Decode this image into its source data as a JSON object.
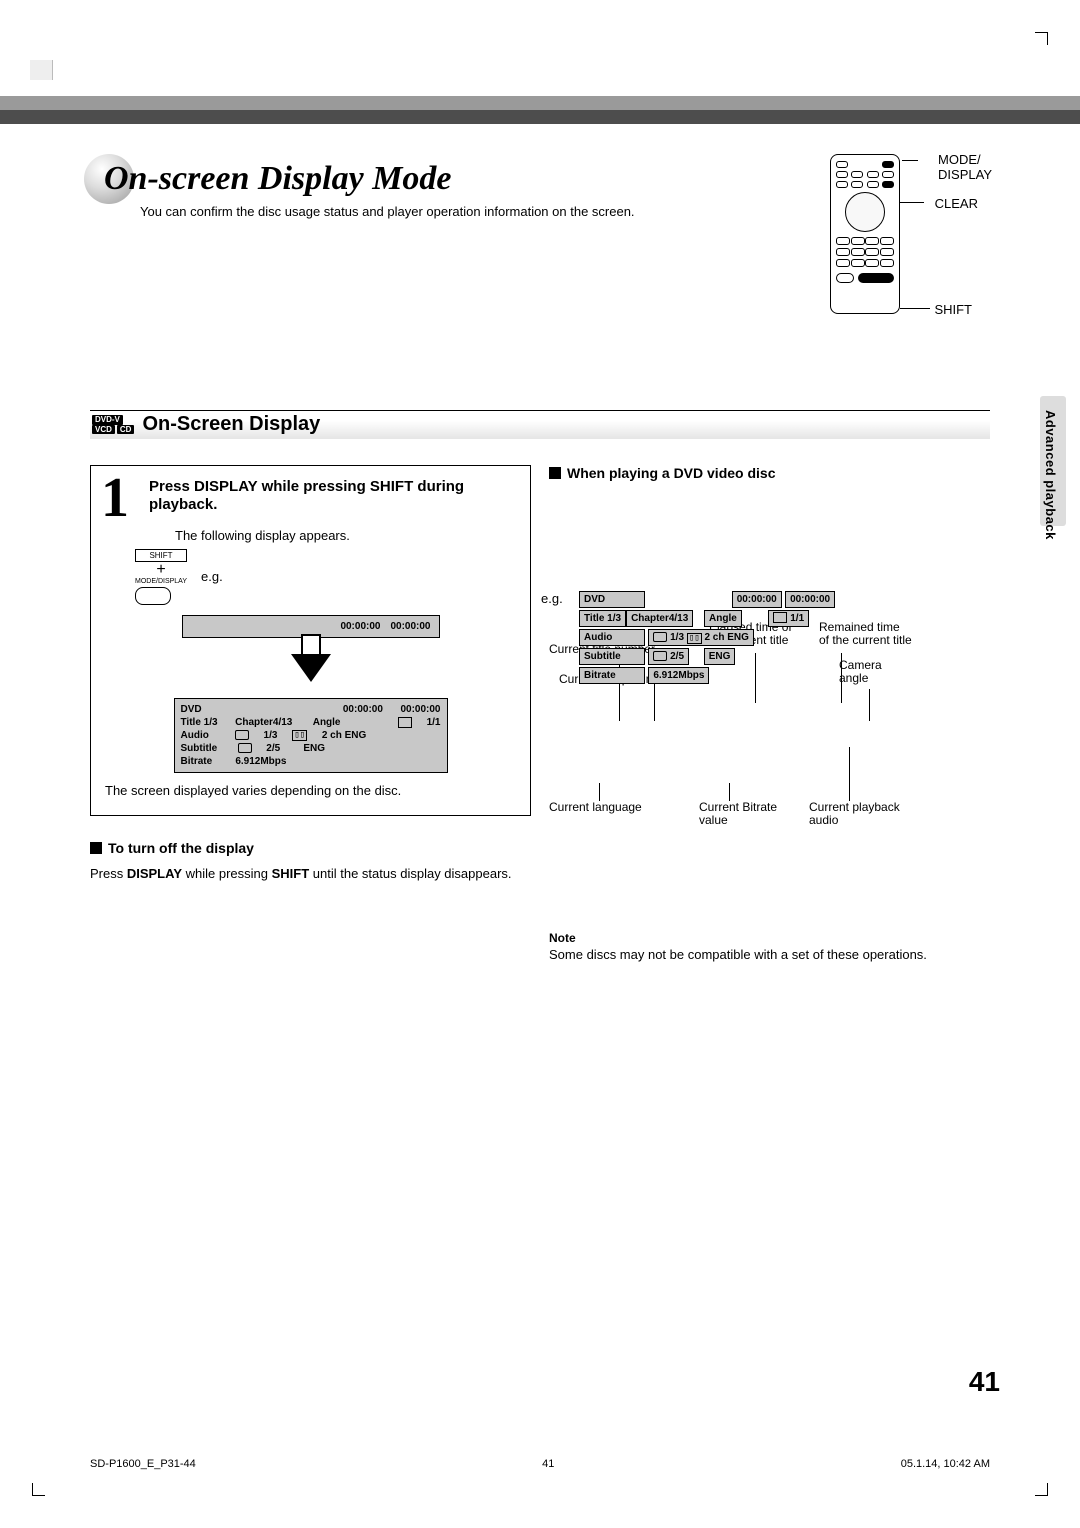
{
  "header": {
    "title": "On-screen Display Mode",
    "intro": "You can confirm the disc usage status and player operation information on the screen."
  },
  "remote_labels": {
    "mode_display": "MODE/\nDISPLAY",
    "clear": "CLEAR",
    "shift": "SHIFT"
  },
  "section": {
    "badges": [
      "DVD-V",
      "VCD",
      "CD"
    ],
    "heading": "On-Screen Display"
  },
  "step1": {
    "number": "1",
    "title": "Press DISPLAY while pressing SHIFT during playback.",
    "following": "The following display appears.",
    "eg": "e.g.",
    "shift": "SHIFT",
    "mode_display": "MODE/DISPLAY",
    "osd_small": {
      "t1": "00:00:00",
      "t2": "00:00:00"
    },
    "osd_large": {
      "l1a": "DVD",
      "l1b": "00:00:00",
      "l1c": "00:00:00",
      "l2a": "Title 1/3",
      "l2b": "Chapter4/13",
      "l2c": "Angle",
      "l2d": "1/1",
      "l3a": "Audio",
      "l3b": "1/3",
      "l3c": "2 ch ENG",
      "l4a": "Subtitle",
      "l4b": "2/5",
      "l4c": "ENG",
      "l5a": "Bitrate",
      "l5b": "6.912Mbps"
    },
    "varies": "The screen displayed varies depending on the disc."
  },
  "turn_off": {
    "heading": "To turn off the display",
    "text_a": "Press ",
    "text_b": "DISPLAY",
    "text_c": " while pressing ",
    "text_d": "SHIFT",
    "text_e": " until the status display disappears."
  },
  "right": {
    "heading": "When playing a DVD video disc",
    "callouts": {
      "cur_title": "Current title number",
      "cur_chapter": "Current chapter number",
      "elapsed": "Elapsed time of\nthe current title",
      "remained": "Remained time\nof the current title",
      "camera": "Camera\nangle",
      "cur_lang": "Current language",
      "cur_bitrate": "Current Bitrate\nvalue",
      "cur_audio": "Current playback\naudio"
    },
    "eg": "e.g.",
    "osd": {
      "l1a": "DVD",
      "l1b": "00:00:00",
      "l1c": "00:00:00",
      "l2a": "Title 1/3",
      "l2b": "Chapter4/13",
      "l2c": "Angle",
      "l2d": "1/1",
      "l3a": "Audio",
      "l3b": "1/3",
      "l3c": "2 ch ENG",
      "l4a": "Subtitle",
      "l4b": "2/5",
      "l4c": "ENG",
      "l5a": "Bitrate",
      "l5b": "6.912Mbps"
    },
    "note_heading": "Note",
    "note_text": "Some discs may not be compatible with a set of these operations."
  },
  "side_tab": "Advanced playback",
  "page_number": "41",
  "footer": {
    "left": "SD-P1600_E_P31-44",
    "center": "41",
    "right": "05.1.14, 10:42 AM"
  }
}
